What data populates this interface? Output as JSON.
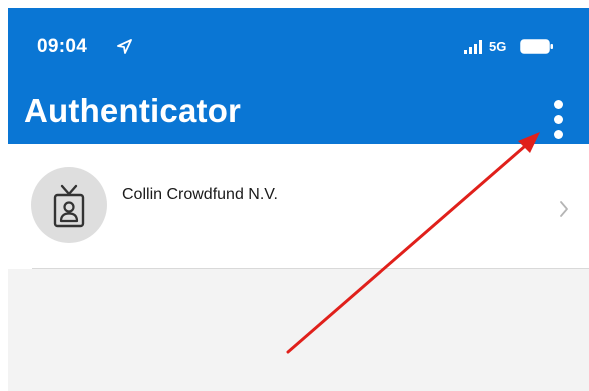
{
  "status_bar": {
    "time": "09:04",
    "network": "5G",
    "location_icon": "location-arrow-icon",
    "signal_icon": "signal-bars-icon",
    "battery_icon": "battery-icon"
  },
  "header": {
    "title": "Authenticator",
    "more_icon": "more-vertical-icon",
    "background_color": "#0a76d4"
  },
  "accounts": [
    {
      "name": "Collin Crowdfund N.V.",
      "avatar_icon": "id-badge-icon",
      "chevron_icon": "chevron-right-icon"
    }
  ],
  "annotation": {
    "type": "arrow",
    "color": "#e0201b",
    "points_to": "more-options-button"
  }
}
